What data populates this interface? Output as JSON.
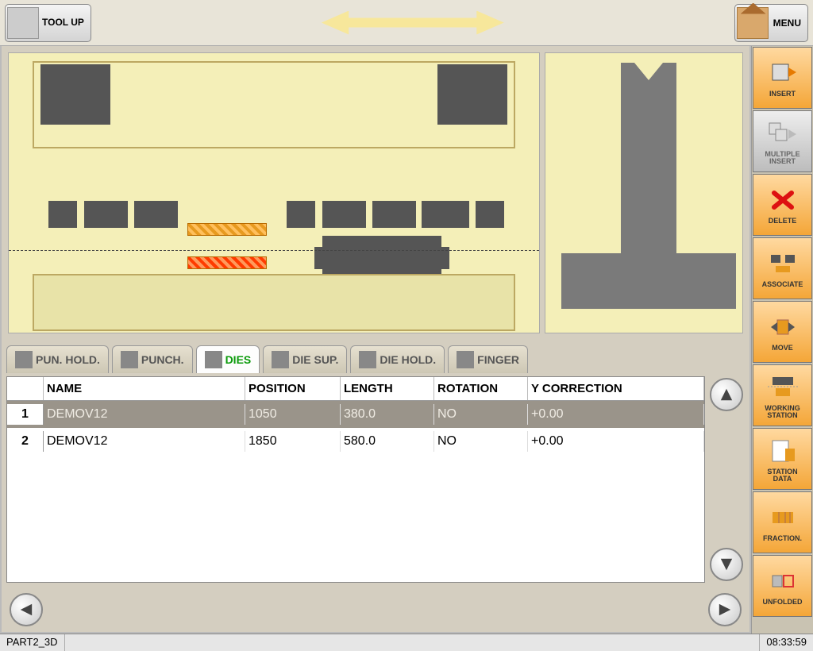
{
  "topbar": {
    "tool_up_label": "TOOL UP",
    "menu_label": "MENU"
  },
  "tabs": [
    {
      "label": "PUN. HOLD."
    },
    {
      "label": "PUNCH."
    },
    {
      "label": "DIES"
    },
    {
      "label": "DIE SUP."
    },
    {
      "label": "DIE HOLD."
    },
    {
      "label": "FINGER"
    }
  ],
  "active_tab_index": 2,
  "grid": {
    "headers": {
      "name": "NAME",
      "position": "POSITION",
      "length": "LENGTH",
      "rotation": "ROTATION",
      "ycorrection": "Y CORRECTION"
    },
    "rows": [
      {
        "idx": "1",
        "name": "DEMOV12",
        "position": "1050",
        "length": "380.0",
        "rotation": "NO",
        "ycorr": "+0.00"
      },
      {
        "idx": "2",
        "name": "DEMOV12",
        "position": "1850",
        "length": "580.0",
        "rotation": "NO",
        "ycorr": "+0.00"
      }
    ],
    "selected_row": 0
  },
  "sidebar": [
    {
      "label": "INSERT",
      "style": "orange"
    },
    {
      "label": "MULTIPLE\nINSERT",
      "style": "gray"
    },
    {
      "label": "DELETE",
      "style": "orange"
    },
    {
      "label": "ASSOCIATE",
      "style": "orange"
    },
    {
      "label": "MOVE",
      "style": "orange"
    },
    {
      "label": "WORKING\nSTATION",
      "style": "orange"
    },
    {
      "label": "STATION\nDATA",
      "style": "orange"
    },
    {
      "label": "FRACTION.",
      "style": "orange"
    },
    {
      "label": "UNFOLDED",
      "style": "orange"
    }
  ],
  "statusbar": {
    "program": "PART2_3D",
    "time": "08:33:59"
  }
}
